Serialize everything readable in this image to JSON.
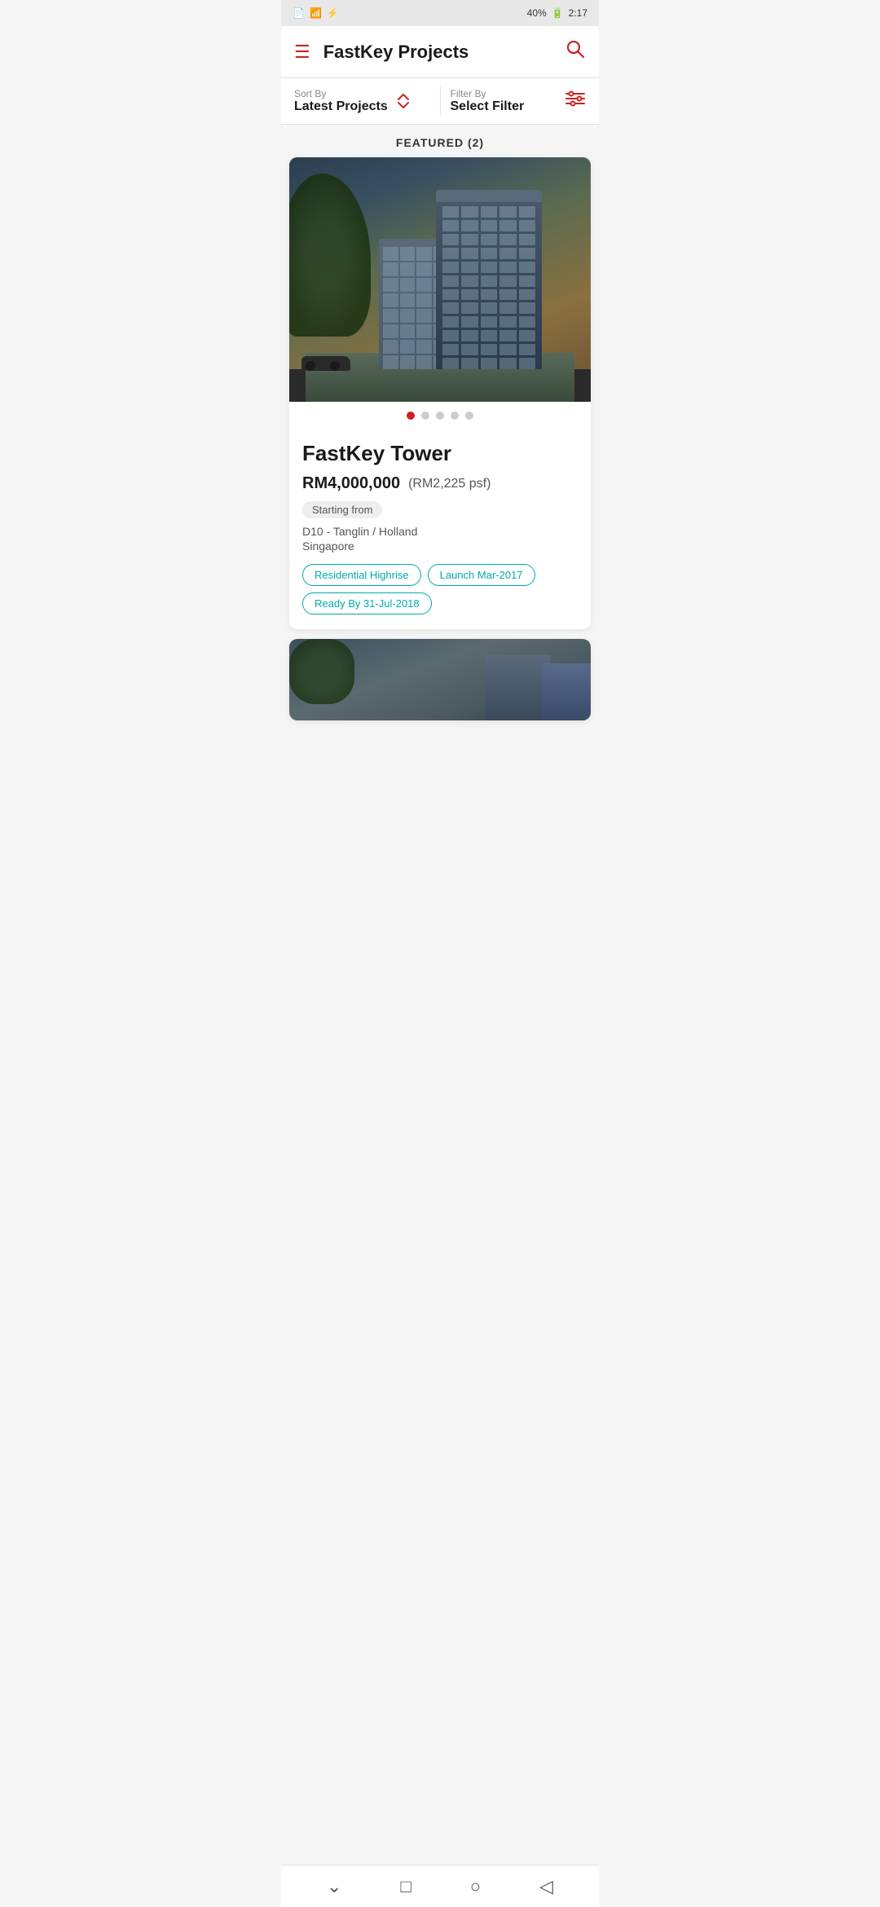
{
  "statusBar": {
    "leftIcons": [
      "📄",
      "📶",
      "🔌"
    ],
    "battery": "40%",
    "time": "2:17"
  },
  "header": {
    "title": "FastKey Projects",
    "menuIcon": "☰",
    "searchIcon": "🔍"
  },
  "sortFilter": {
    "sortLabel": "Sort By",
    "sortValue": "Latest Projects",
    "filterLabel": "Filter By",
    "filterValue": "Select Filter"
  },
  "featured": {
    "label": "FEATURED (2)"
  },
  "card1": {
    "projectName": "FastKey Tower",
    "priceMain": "RM4,000,000",
    "pricePsf": "(RM2,225 psf)",
    "startingFrom": "Starting from",
    "locationLine1": "D10 - Tanglin / Holland",
    "locationLine2": "Singapore",
    "tags": [
      "Residential Highrise",
      "Launch Mar-2017",
      "Ready By 31-Jul-2018"
    ],
    "dots": [
      true,
      false,
      false,
      false,
      false
    ]
  },
  "bottomNav": {
    "icons": [
      "∨",
      "□",
      "○",
      "◁"
    ]
  }
}
